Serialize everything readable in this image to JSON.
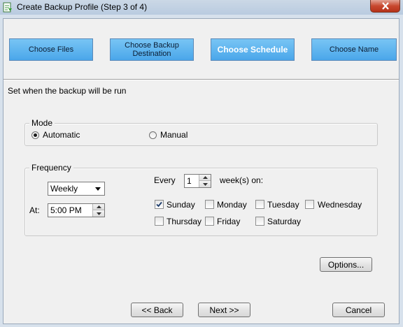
{
  "window": {
    "title": "Create Backup Profile (Step 3 of 4)",
    "icons": {
      "app": "backup-doc-icon",
      "close": "close-icon"
    }
  },
  "steps": [
    {
      "label": "Choose Files",
      "active": false
    },
    {
      "label": "Choose Backup Destination",
      "active": false
    },
    {
      "label": "Choose Schedule",
      "active": true
    },
    {
      "label": "Choose Name",
      "active": false
    }
  ],
  "subtitle": "Set when the backup will be run",
  "mode": {
    "legend": "Mode",
    "options": [
      {
        "label": "Automatic",
        "selected": true
      },
      {
        "label": "Manual",
        "selected": false
      }
    ]
  },
  "frequency": {
    "legend": "Frequency",
    "period": "Weekly",
    "at_label": "At:",
    "time": "5:00 PM",
    "every_label": "Every",
    "every_value": "1",
    "weeks_on_label": "week(s) on:",
    "days": [
      {
        "label": "Sunday",
        "checked": true
      },
      {
        "label": "Monday",
        "checked": false
      },
      {
        "label": "Tuesday",
        "checked": false
      },
      {
        "label": "Wednesday",
        "checked": false
      },
      {
        "label": "Thursday",
        "checked": false
      },
      {
        "label": "Friday",
        "checked": false
      },
      {
        "label": "Saturday",
        "checked": false
      }
    ]
  },
  "buttons": {
    "options": "Options...",
    "back": "<< Back",
    "next": "Next >>",
    "cancel": "Cancel"
  },
  "colors": {
    "step_fill": "#4aa6ea",
    "window_frame": "#d7e1ec",
    "close_button": "#c8482f"
  }
}
